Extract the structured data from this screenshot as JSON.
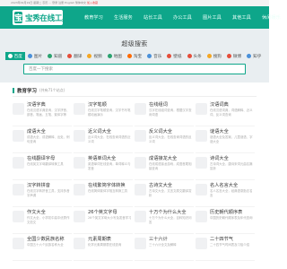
{
  "topbar": {
    "items": [
      "2023年09月19日",
      "星期二",
      "农历 ...",
      "登录",
      "注册",
      "English",
      "繁体中文",
      "加入收藏"
    ]
  },
  "header": {
    "logo_icon": "宝",
    "logo_text": "宝秀在线工具",
    "nav": [
      "教育学习",
      "生活服务",
      "站长工具",
      "办公工具",
      "图片工具",
      "其他工具",
      "休闲娱乐"
    ]
  },
  "search": {
    "title": "超级搜索",
    "categories": [
      {
        "label": "百度",
        "color": "#ffffff",
        "active": true
      },
      {
        "label": "图片",
        "color": "#4a90d9",
        "active": false
      },
      {
        "label": "知道",
        "color": "#2ba26f",
        "active": false
      },
      {
        "label": "翻译",
        "color": "#e44d3a",
        "active": false
      },
      {
        "label": "视频",
        "color": "#f5a623",
        "active": false
      },
      {
        "label": "地图",
        "color": "#2ba26f",
        "active": false
      },
      {
        "label": "淘宝",
        "color": "#ff6a00",
        "active": false
      },
      {
        "label": "音乐",
        "color": "#4a90d9",
        "active": false
      },
      {
        "label": "壁纸",
        "color": "#e44d3a",
        "active": false
      },
      {
        "label": "头条",
        "color": "#e44d3a",
        "active": false
      },
      {
        "label": "搜狗",
        "color": "#f5a623",
        "active": false
      },
      {
        "label": "微博",
        "color": "#e44d3a",
        "active": false
      },
      {
        "label": "知乎",
        "color": "#4a90d9",
        "active": false
      }
    ],
    "placeholder": "百度一下搜索"
  },
  "section": {
    "title": "教育学习",
    "count": "(共有71个站点)",
    "cards": [
      {
        "name": "汉语字典",
        "desc": "在线汉语字典查询，汉字拼音、部首、笔画、五笔、繁体字等"
      },
      {
        "name": "汉字笔顺",
        "desc": "在线汉字笔顺查询，汉字书写笔顺动画演示"
      },
      {
        "name": "在线组词",
        "desc": "汉字在线组词查询，根据汉字查询词语"
      },
      {
        "name": "汉语词典",
        "desc": "在线汉语词典，词语解释、近义词、反义词查询"
      },
      {
        "name": "成语大全",
        "desc": "成语大全，成语解释、出处、例句查询"
      },
      {
        "name": "近义词大全",
        "desc": "近义词大全，在线查询词语的近义词"
      },
      {
        "name": "反义词大全",
        "desc": "反义词大全，在线查询词语的反义词"
      },
      {
        "name": "谜语大全",
        "desc": "谜语大全及答案，儿童谜语、字谜大全"
      },
      {
        "name": "在线翻译字母",
        "desc": "在线英文字母翻译转换工具"
      },
      {
        "name": "英语单词大全",
        "desc": "英语单词在线查询，单词释义与发音"
      },
      {
        "name": "成语接龙大全",
        "desc": "在线成语接龙游戏，成语首尾相接查询"
      },
      {
        "name": "诗词大全",
        "desc": "古诗词大全，唐诗宋词元曲名篇赏析"
      },
      {
        "name": "汉字转拼音",
        "desc": "在线汉字转拼音工具，支持多音字声调"
      },
      {
        "name": "在线繁简字体转换",
        "desc": "在线简体繁体字相互转换工具"
      },
      {
        "name": "古诗文大全",
        "desc": "古诗文大全，文言文原文翻译赏析"
      },
      {
        "name": "名人名言大全",
        "desc": "名人名言大全，经典语录励志名言"
      },
      {
        "name": "作文大全",
        "desc": "作文大全，小学初中高中优秀作文范文"
      },
      {
        "name": "26个英文字母",
        "desc": "26个英文字母大小写及发音学习"
      },
      {
        "name": "十万个为什么大全",
        "desc": "十万个为什么大全，百科知识问答"
      },
      {
        "name": "历史朝代顺序表",
        "desc": "中国历史朝代顺序表及年代查询"
      },
      {
        "name": "全国少数民族名称",
        "desc": "中国五十六个民族名称大全"
      },
      {
        "name": "元素周期表",
        "desc": "化学元素周期表在线查询"
      },
      {
        "name": "三十六计",
        "desc": "三十六计全文及解释"
      },
      {
        "name": "二十四节气",
        "desc": "二十四节气时间表及习俗介绍"
      }
    ]
  }
}
